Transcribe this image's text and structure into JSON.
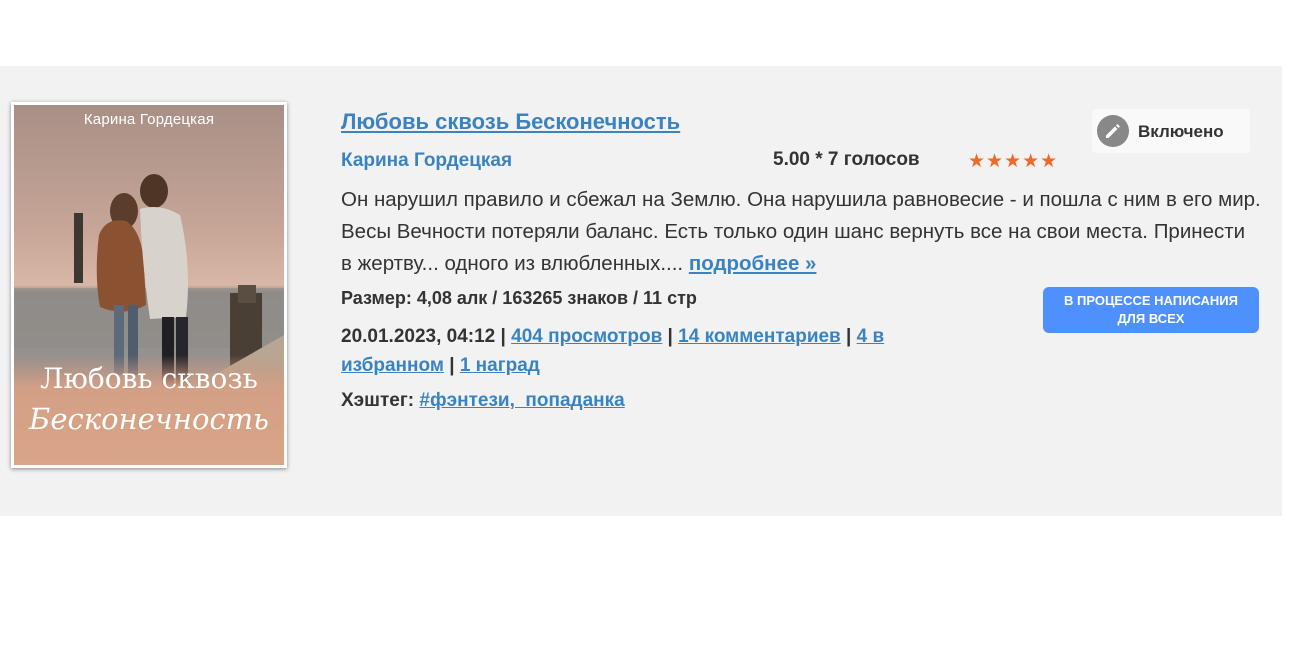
{
  "book": {
    "cover": {
      "author": "Карина Гордецкая",
      "title_line1": "Любовь сквозь",
      "title_line2": "Бесконечность"
    },
    "title": "Любовь сквозь Бесконечность",
    "author": "Карина Гордецкая",
    "rating_text": "5.00 * 7 голосов",
    "stars": "★★★★★",
    "stars_value": 5,
    "toggle_label": "Включено",
    "description": "Он нарушил правило и сбежал на Землю. Она нарушила равновесие - и пошла с ним в его мир. Весы Вечности потеряли баланс. Есть только один шанс вернуть все на свои места. Принести в жертву... одного из влюбленных....",
    "more_link": "подробнее »",
    "size_text": "Размер: 4,08 алк / 163265 знаков / 11 стр",
    "status_badge": {
      "line1": "В ПРОЦЕССЕ НАПИСАНИЯ",
      "line2": "ДЛЯ ВСЕХ"
    },
    "date": "20.01.2023, 04:12",
    "sep": "|",
    "views_link": "404 просмотров",
    "comments_link": "14 комментариев",
    "favorites_link": "4 в избранном",
    "awards_link": "1 наград",
    "hashtag_label": "Хэштег:",
    "hashtags_link": "#фэнтези,  попаданка"
  },
  "colors": {
    "link": "#3b83c0",
    "star": "#ef6a2a",
    "badge": "#4d90fe",
    "card_bg": "#f2f2f2"
  },
  "icons": {
    "toggle": "pencil-icon"
  }
}
